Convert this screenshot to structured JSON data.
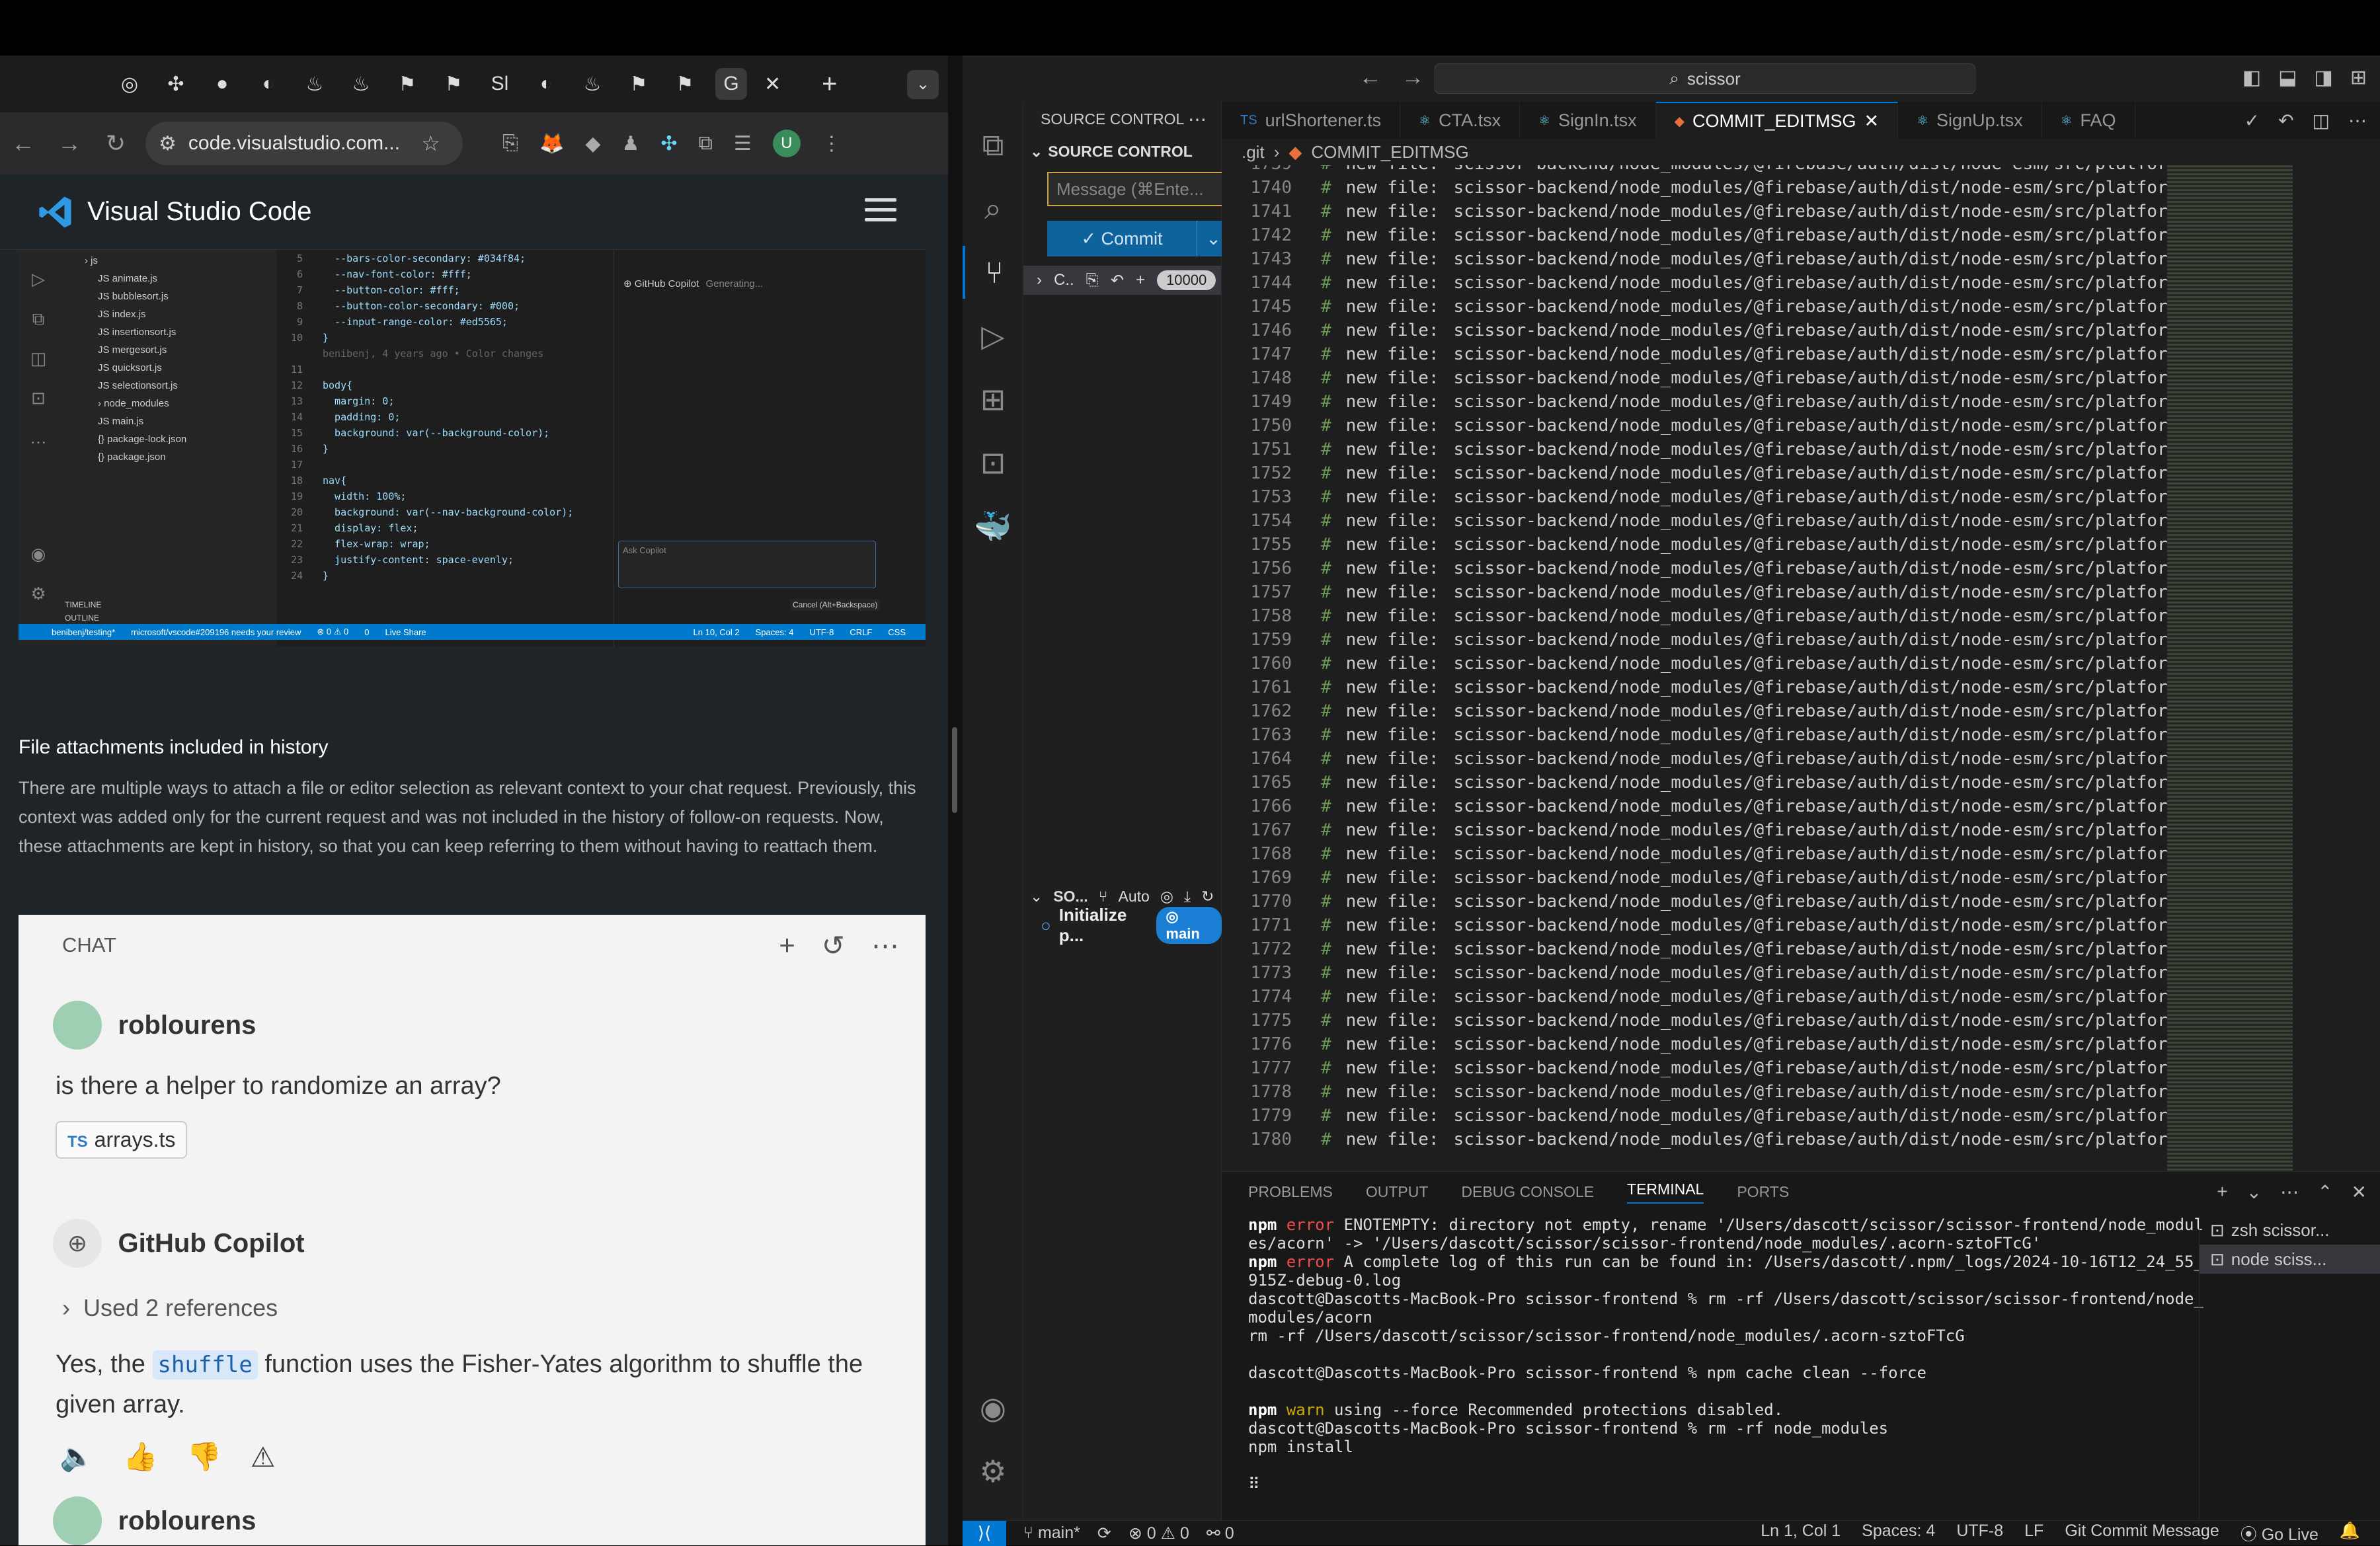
{
  "browser": {
    "tab_icons": [
      "◎",
      "✣",
      "●",
      "◐",
      "♨",
      "♨",
      "⚑",
      "⚑",
      "Sl",
      "◐",
      "♨",
      "⚑",
      "⚑",
      "G"
    ],
    "close_tab": "✕",
    "new_tab": "+",
    "url": "code.visualstudio.com...",
    "site_title": "Visual Studio Code"
  },
  "embedded": {
    "tree_items": [
      "js",
      "animate.js",
      "bubblesort.js",
      "index.js",
      "insertionsort.js",
      "mergesort.js",
      "quicksort.js",
      "selectionsort.js",
      "node_modules",
      "main.js",
      "package-lock.json",
      "package.json"
    ],
    "code_lines": [
      {
        "n": "5",
        "t": "  --bars-color-secondary: #034f84;"
      },
      {
        "n": "6",
        "t": "  --nav-font-color: #fff;"
      },
      {
        "n": "7",
        "t": "  --button-color: #fff;"
      },
      {
        "n": "8",
        "t": "  --button-color-secondary: #000;"
      },
      {
        "n": "9",
        "t": "  --input-range-color: #ed5565;"
      },
      {
        "n": "10",
        "t": "}"
      },
      {
        "n": "11",
        "t": ""
      },
      {
        "n": "12",
        "t": "body{"
      },
      {
        "n": "13",
        "t": "  margin: 0;"
      },
      {
        "n": "14",
        "t": "  padding: 0;"
      },
      {
        "n": "15",
        "t": "  background: var(--background-color);"
      },
      {
        "n": "16",
        "t": "}"
      },
      {
        "n": "17",
        "t": ""
      },
      {
        "n": "18",
        "t": "nav{"
      },
      {
        "n": "19",
        "t": "  width: 100%;"
      },
      {
        "n": "20",
        "t": "  background: var(--nav-background-color);"
      },
      {
        "n": "21",
        "t": "  display: flex;"
      },
      {
        "n": "22",
        "t": "  flex-wrap: wrap;"
      },
      {
        "n": "23",
        "t": "  justify-content: space-evenly;"
      },
      {
        "n": "24",
        "t": "}"
      }
    ],
    "blame": "benibenj, 4 years ago • Color changes",
    "copilot_label": "GitHub Copilot",
    "copilot_status": "Generating...",
    "ask_copilot": "Ask Copilot",
    "cancel_hint": "Cancel (Alt+Backspace)",
    "timeline": "TIMELINE",
    "outline": "OUTLINE",
    "status_left": "benibenj/testing*",
    "status_pr": "microsoft/vscode#209196 needs your review",
    "status_errors": "⊗ 0 ⚠ 0",
    "status_ports": "0",
    "status_share": "Live Share",
    "status_pos": "Ln 10, Col 2",
    "status_spaces": "Spaces: 4",
    "status_enc": "UTF-8",
    "status_eol": "CRLF",
    "status_lang": "CSS"
  },
  "article": {
    "heading": "File attachments included in history",
    "body": "There are multiple ways to attach a file or editor selection as relevant context to your chat request. Previously, this context was added only for the current request and was not included in the history of follow-on requests. Now, these attachments are kept in history, so that you can keep referring to them without having to reattach them."
  },
  "chat": {
    "title": "CHAT",
    "user1_name": "roblourens",
    "user1_msg": "is there a helper to randomize an array?",
    "ref_lang": "TS",
    "ref_file": "arrays.ts",
    "copilot_name": "GitHub Copilot",
    "used_refs": "Used 2 references",
    "answer_pre": "Yes, the ",
    "answer_code": "shuffle",
    "answer_post": " function uses the Fisher-Yates algorithm to shuffle the given array.",
    "user2_name": "roblourens"
  },
  "vscode": {
    "search": "scissor",
    "sidebar_title": "SOURCE CONTROL",
    "section_title": "SOURCE CONTROL",
    "commit_placeholder": "Message (⌘Ente...",
    "commit_label": "✓ Commit",
    "changes_label": "C..",
    "changes_count": "10000",
    "graph_title": "SO...",
    "graph_auto": "Auto",
    "graph_commit": "Initialize p...",
    "graph_branch": "main",
    "tabs": [
      {
        "icon": "TS",
        "label": "urlShortener.ts",
        "active": false
      },
      {
        "icon": "⚛",
        "label": "CTA.tsx",
        "active": false
      },
      {
        "icon": "⚛",
        "label": "SignIn.tsx",
        "active": false
      },
      {
        "icon": "◆",
        "label": "COMMIT_EDITMSG",
        "active": true
      },
      {
        "icon": "⚛",
        "label": "SignUp.tsx",
        "active": false
      },
      {
        "icon": "⚛",
        "label": "FAQ",
        "active": false
      }
    ],
    "breadcrumb_dir": ".git",
    "breadcrumb_file": "COMMIT_EDITMSG",
    "editor_line_start": 1739,
    "editor_line_count": 42,
    "editor_hash": "#",
    "editor_kind": "new file:",
    "editor_path": "scissor-backend/node_modules/@firebase/auth/dist/node-esm/src/platform_brow",
    "panel_tabs": [
      "PROBLEMS",
      "OUTPUT",
      "DEBUG CONSOLE",
      "TERMINAL",
      "PORTS"
    ],
    "terminal_lines": [
      {
        "cls": "",
        "pre": "npm ",
        "tag": "error",
        "tagcls": "err",
        "rest": " ENOTEMPTY: directory not empty, rename '/Users/dascott/scissor/scissor-frontend/node_modul"
      },
      {
        "cls": "",
        "pre": "",
        "tag": "",
        "tagcls": "",
        "rest": "es/acorn' -> '/Users/dascott/scissor/scissor-frontend/node_modules/.acorn-sztoFTcG'"
      },
      {
        "cls": "",
        "pre": "npm ",
        "tag": "error",
        "tagcls": "err",
        "rest": " A complete log of this run can be found in: /Users/dascott/.npm/_logs/2024-10-16T12_24_55_"
      },
      {
        "cls": "",
        "pre": "",
        "tag": "",
        "tagcls": "",
        "rest": "915Z-debug-0.log"
      },
      {
        "cls": "",
        "pre": "",
        "tag": "",
        "tagcls": "",
        "rest": "dascott@Dascotts-MacBook-Pro scissor-frontend % rm -rf /Users/dascott/scissor/scissor-frontend/node_"
      },
      {
        "cls": "",
        "pre": "",
        "tag": "",
        "tagcls": "",
        "rest": "modules/acorn"
      },
      {
        "cls": "",
        "pre": "",
        "tag": "",
        "tagcls": "",
        "rest": "rm -rf /Users/dascott/scissor/scissor-frontend/node_modules/.acorn-sztoFTcG"
      },
      {
        "cls": "",
        "pre": "",
        "tag": "",
        "tagcls": "",
        "rest": ""
      },
      {
        "cls": "",
        "pre": "",
        "tag": "",
        "tagcls": "",
        "rest": "dascott@Dascotts-MacBook-Pro scissor-frontend % npm cache clean --force"
      },
      {
        "cls": "",
        "pre": "",
        "tag": "",
        "tagcls": "",
        "rest": ""
      },
      {
        "cls": "",
        "pre": "npm ",
        "tag": "warn",
        "tagcls": "warn",
        "rest": " using --force Recommended protections disabled."
      },
      {
        "cls": "",
        "pre": "",
        "tag": "",
        "tagcls": "",
        "rest": "dascott@Dascotts-MacBook-Pro scissor-frontend % rm -rf node_modules"
      },
      {
        "cls": "",
        "pre": "",
        "tag": "",
        "tagcls": "",
        "rest": "npm install"
      },
      {
        "cls": "",
        "pre": "",
        "tag": "",
        "tagcls": "",
        "rest": ""
      },
      {
        "cls": "",
        "pre": "",
        "tag": "",
        "tagcls": "",
        "rest": "⠿"
      }
    ],
    "term_list": [
      "zsh scissor...",
      "node sciss..."
    ],
    "status": {
      "branch": "main*",
      "problems": "⊗ 0 ⚠ 0",
      "ports": "0",
      "position": "Ln 1, Col 1",
      "spaces": "Spaces: 4",
      "encoding": "UTF-8",
      "eol": "LF",
      "language": "Git Commit Message",
      "golive": "Go Live"
    }
  }
}
